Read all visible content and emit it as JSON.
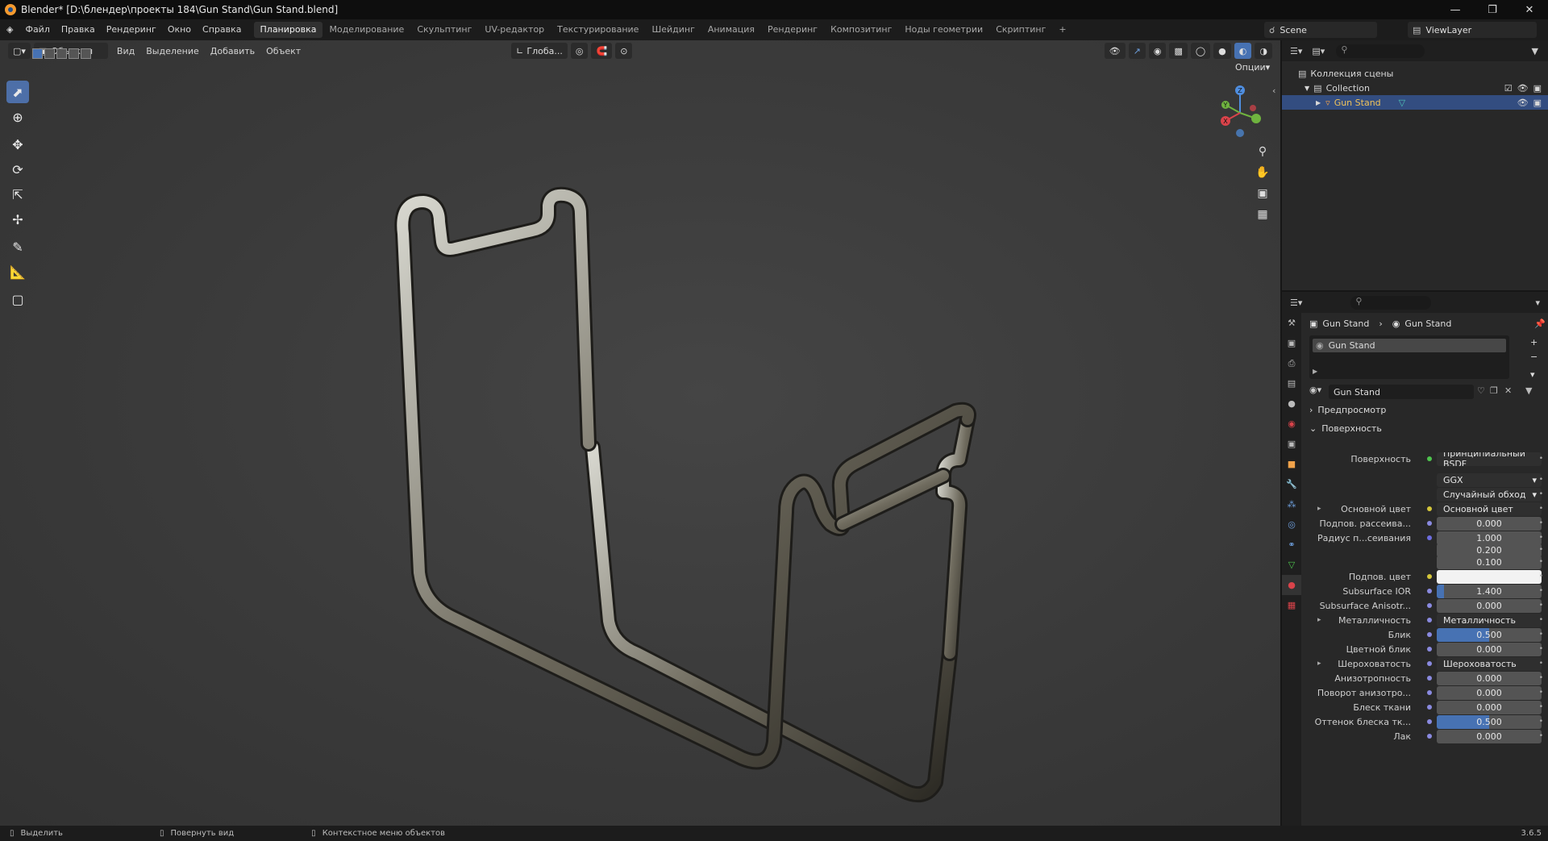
{
  "window": {
    "title": "Blender* [D:\\блендер\\проекты 184\\Gun Stand\\Gun Stand.blend]"
  },
  "main_menu": [
    "Файл",
    "Правка",
    "Рендеринг",
    "Окно",
    "Справка"
  ],
  "workspaces": [
    "Планировка",
    "Моделирование",
    "Скульптинг",
    "UV-редактор",
    "Текстурирование",
    "Шейдинг",
    "Анимация",
    "Рендеринг",
    "Композитинг",
    "Ноды геометрии",
    "Скриптинг"
  ],
  "active_workspace": "Планировка",
  "scene": {
    "name": "Scene",
    "view_layer": "ViewLayer"
  },
  "viewport_header": {
    "mode": "Объекты",
    "menus": [
      "Вид",
      "Выделение",
      "Добавить",
      "Объект"
    ],
    "transform_orientation": "Глоба...",
    "options": "Опции"
  },
  "gizmo": {
    "z": "Z",
    "y": "Y",
    "x": "X"
  },
  "outliner": {
    "scene_collection": "Коллекция сцены",
    "collection": "Collection",
    "object": "Gun Stand"
  },
  "properties": {
    "breadcrumb_object": "Gun Stand",
    "breadcrumb_material": "Gun Stand",
    "slot_name": "Gun Stand",
    "material_name": "Gun Stand",
    "panels": {
      "preview": "Предпросмотр",
      "surface": "Поверхность"
    },
    "rows": [
      {
        "label": "Поверхность",
        "value": "Принципиальный BSDF",
        "kind": "link",
        "dot": "#4ec44e"
      },
      {
        "label": "",
        "value": "GGX",
        "kind": "dropdown"
      },
      {
        "label": "",
        "value": "Случайный обход",
        "kind": "dropdown"
      },
      {
        "label": "Основной цвет",
        "value": "Основной цвет",
        "kind": "link",
        "dot": "#d4c63a",
        "expand": true
      },
      {
        "label": "Подпов. рассеива...",
        "value": "0.000",
        "kind": "num",
        "dot": "#8a8ae0"
      },
      {
        "label": "Радиус п...сеивания",
        "value": "1.000",
        "kind": "num",
        "dot": "#6d6de0"
      },
      {
        "label": "",
        "value": "0.200",
        "kind": "num"
      },
      {
        "label": "",
        "value": "0.100",
        "kind": "num"
      },
      {
        "label": "Подпов. цвет",
        "value": "",
        "kind": "color",
        "dot": "#d4c63a"
      },
      {
        "label": "Subsurface IOR",
        "value": "1.400",
        "kind": "num",
        "dot": "#8a8ae0",
        "fill": 0.07
      },
      {
        "label": "Subsurface Anisotr...",
        "value": "0.000",
        "kind": "num",
        "dot": "#8a8ae0"
      },
      {
        "label": "Металличность",
        "value": "Металличность",
        "kind": "link",
        "dot": "#8a8ae0",
        "expand": true
      },
      {
        "label": "Блик",
        "value": "0.500",
        "kind": "num",
        "dot": "#8a8ae0",
        "fill": 0.5
      },
      {
        "label": "Цветной блик",
        "value": "0.000",
        "kind": "num",
        "dot": "#8a8ae0"
      },
      {
        "label": "Шероховатость",
        "value": "Шероховатость",
        "kind": "link",
        "dot": "#8a8ae0",
        "expand": true
      },
      {
        "label": "Анизотропность",
        "value": "0.000",
        "kind": "num",
        "dot": "#8a8ae0"
      },
      {
        "label": "Поворот анизотро...",
        "value": "0.000",
        "kind": "num",
        "dot": "#8a8ae0"
      },
      {
        "label": "Блеск ткани",
        "value": "0.000",
        "kind": "num",
        "dot": "#8a8ae0"
      },
      {
        "label": "Оттенок блеска тк...",
        "value": "0.500",
        "kind": "num",
        "dot": "#8a8ae0",
        "fill": 0.5
      },
      {
        "label": "Лак",
        "value": "0.000",
        "kind": "num",
        "dot": "#8a8ae0"
      }
    ]
  },
  "statusbar": {
    "select": "Выделить",
    "rotate": "Повернуть вид",
    "context": "Контекстное меню объектов",
    "version": "3.6.5"
  }
}
